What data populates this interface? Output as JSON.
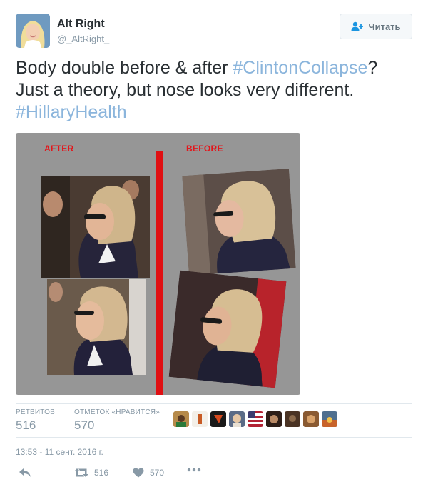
{
  "user": {
    "display_name": "Alt Right",
    "handle": "@_AltRight_"
  },
  "follow_button": {
    "label": "Читать"
  },
  "tweet": {
    "text_1": "Body double before & after ",
    "hashtag_1": "#ClintonCollapse",
    "text_2": "?",
    "text_3": "Just a theory, but nose looks very different.",
    "hashtag_2": "#HillaryHealth"
  },
  "media": {
    "label_after": "AFTER",
    "label_before": "BEFORE"
  },
  "stats": {
    "retweets_label": "РЕТВИТОВ",
    "retweets_value": "516",
    "likes_label": "ОТМЕТОК «НРАВИТСЯ»",
    "likes_value": "570"
  },
  "timestamp": "13:53 - 11 сент. 2016 г.",
  "actions": {
    "retweet_count": "516",
    "like_count": "570"
  },
  "colors": {
    "link": "#8bb5dc",
    "text": "#292f33",
    "muted": "#8899a6",
    "red_label": "#e3161b"
  },
  "icons": [
    "follow-icon",
    "reply-icon",
    "retweet-icon",
    "like-icon",
    "more-icon"
  ]
}
